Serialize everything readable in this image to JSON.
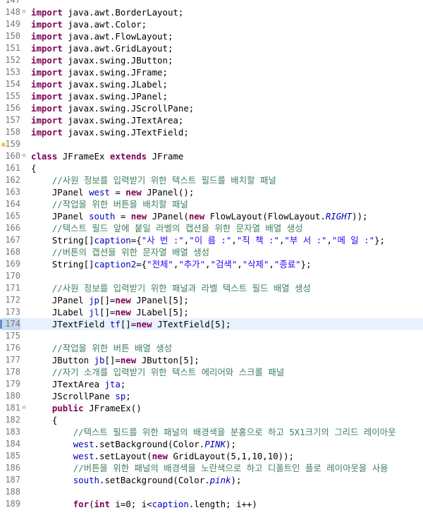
{
  "editor": {
    "lines": [
      {
        "num": "147",
        "tokens": []
      },
      {
        "num": "148",
        "fold": "⊖",
        "tokens": [
          {
            "t": "kw",
            "v": "import"
          },
          {
            "t": "tx",
            "v": " java.awt.BorderLayout;"
          }
        ]
      },
      {
        "num": "149",
        "tokens": [
          {
            "t": "kw",
            "v": "import"
          },
          {
            "t": "tx",
            "v": " java.awt.Color;"
          }
        ]
      },
      {
        "num": "150",
        "tokens": [
          {
            "t": "kw",
            "v": "import"
          },
          {
            "t": "tx",
            "v": " java.awt.FlowLayout;"
          }
        ]
      },
      {
        "num": "151",
        "tokens": [
          {
            "t": "kw",
            "v": "import"
          },
          {
            "t": "tx",
            "v": " java.awt.GridLayout;"
          }
        ]
      },
      {
        "num": "152",
        "tokens": [
          {
            "t": "kw",
            "v": "import"
          },
          {
            "t": "tx",
            "v": " javax.swing.JButton;"
          }
        ]
      },
      {
        "num": "153",
        "tokens": [
          {
            "t": "kw",
            "v": "import"
          },
          {
            "t": "tx",
            "v": " javax.swing.JFrame;"
          }
        ]
      },
      {
        "num": "154",
        "tokens": [
          {
            "t": "kw",
            "v": "import"
          },
          {
            "t": "tx",
            "v": " javax.swing.JLabel;"
          }
        ]
      },
      {
        "num": "155",
        "tokens": [
          {
            "t": "kw",
            "v": "import"
          },
          {
            "t": "tx",
            "v": " javax.swing.JPanel;"
          }
        ]
      },
      {
        "num": "156",
        "tokens": [
          {
            "t": "kw",
            "v": "import"
          },
          {
            "t": "tx",
            "v": " javax.swing.JScrollPane;"
          }
        ]
      },
      {
        "num": "157",
        "tokens": [
          {
            "t": "kw",
            "v": "import"
          },
          {
            "t": "tx",
            "v": " javax.swing.JTextArea;"
          }
        ]
      },
      {
        "num": "158",
        "tokens": [
          {
            "t": "kw",
            "v": "import"
          },
          {
            "t": "tx",
            "v": " javax.swing.JTextField;"
          }
        ]
      },
      {
        "num": "159",
        "warning": true,
        "tokens": []
      },
      {
        "num": "160",
        "fold": "⊖",
        "tokens": [
          {
            "t": "kw",
            "v": "class"
          },
          {
            "t": "tx",
            "v": " JFrameEx "
          },
          {
            "t": "kw",
            "v": "extends"
          },
          {
            "t": "tx",
            "v": " JFrame"
          }
        ]
      },
      {
        "num": "161",
        "tokens": [
          {
            "t": "tx",
            "v": "{"
          }
        ]
      },
      {
        "num": "162",
        "tokens": [
          {
            "t": "tx",
            "v": "    "
          },
          {
            "t": "cm",
            "v": "//사원 정보를 입력받기 위한 텍스트 필드를 배치할 패널"
          }
        ]
      },
      {
        "num": "163",
        "tokens": [
          {
            "t": "tx",
            "v": "    JPanel "
          },
          {
            "t": "fd",
            "v": "west"
          },
          {
            "t": "tx",
            "v": " = "
          },
          {
            "t": "kw",
            "v": "new"
          },
          {
            "t": "tx",
            "v": " JPanel();"
          }
        ]
      },
      {
        "num": "164",
        "tokens": [
          {
            "t": "tx",
            "v": "    "
          },
          {
            "t": "cm",
            "v": "//작업을 위한 버튼을 배치할 패널"
          }
        ]
      },
      {
        "num": "165",
        "tokens": [
          {
            "t": "tx",
            "v": "    JPanel "
          },
          {
            "t": "fd",
            "v": "south"
          },
          {
            "t": "tx",
            "v": " = "
          },
          {
            "t": "kw",
            "v": "new"
          },
          {
            "t": "tx",
            "v": " JPanel("
          },
          {
            "t": "kw",
            "v": "new"
          },
          {
            "t": "tx",
            "v": " FlowLayout(FlowLayout."
          },
          {
            "t": "it",
            "v": "RIGHT"
          },
          {
            "t": "tx",
            "v": "));"
          }
        ]
      },
      {
        "num": "166",
        "tokens": [
          {
            "t": "tx",
            "v": "    "
          },
          {
            "t": "cm",
            "v": "//텍스트 필드 앞에 붙일 라벨의 캡션을 위한 문자열 배열 생성"
          }
        ]
      },
      {
        "num": "167",
        "tokens": [
          {
            "t": "tx",
            "v": "    String[]"
          },
          {
            "t": "fd",
            "v": "caption"
          },
          {
            "t": "tx",
            "v": "={"
          },
          {
            "t": "st",
            "v": "\"사 번 :\""
          },
          {
            "t": "tx",
            "v": ","
          },
          {
            "t": "st",
            "v": "\"이 름 :\""
          },
          {
            "t": "tx",
            "v": ","
          },
          {
            "t": "st",
            "v": "\"직 책 :\""
          },
          {
            "t": "tx",
            "v": ","
          },
          {
            "t": "st",
            "v": "\"부 서 :\""
          },
          {
            "t": "tx",
            "v": ","
          },
          {
            "t": "st",
            "v": "\"메 일 :\""
          },
          {
            "t": "tx",
            "v": "};"
          }
        ]
      },
      {
        "num": "168",
        "tokens": [
          {
            "t": "tx",
            "v": "    "
          },
          {
            "t": "cm",
            "v": "//버튼의 캡션을 위한 문자열 배열 생성"
          }
        ]
      },
      {
        "num": "169",
        "tokens": [
          {
            "t": "tx",
            "v": "    String[]"
          },
          {
            "t": "fd",
            "v": "caption2"
          },
          {
            "t": "tx",
            "v": "={"
          },
          {
            "t": "st",
            "v": "\"전체\""
          },
          {
            "t": "tx",
            "v": ","
          },
          {
            "t": "st",
            "v": "\"추가\""
          },
          {
            "t": "tx",
            "v": ","
          },
          {
            "t": "st",
            "v": "\"검색\""
          },
          {
            "t": "tx",
            "v": ","
          },
          {
            "t": "st",
            "v": "\"삭제\""
          },
          {
            "t": "tx",
            "v": ","
          },
          {
            "t": "st",
            "v": "\"종료\""
          },
          {
            "t": "tx",
            "v": "};"
          }
        ]
      },
      {
        "num": "170",
        "tokens": []
      },
      {
        "num": "171",
        "tokens": [
          {
            "t": "tx",
            "v": "    "
          },
          {
            "t": "cm",
            "v": "//사원 정보를 입력받기 위한 패널과 라벨 텍스트 필드 배열 생성"
          }
        ]
      },
      {
        "num": "172",
        "tokens": [
          {
            "t": "tx",
            "v": "    JPanel "
          },
          {
            "t": "fd",
            "v": "jp"
          },
          {
            "t": "tx",
            "v": "[]="
          },
          {
            "t": "kw",
            "v": "new"
          },
          {
            "t": "tx",
            "v": " JPanel[5];"
          }
        ]
      },
      {
        "num": "173",
        "tokens": [
          {
            "t": "tx",
            "v": "    JLabel "
          },
          {
            "t": "fd",
            "v": "jl"
          },
          {
            "t": "tx",
            "v": "[]="
          },
          {
            "t": "kw",
            "v": "new"
          },
          {
            "t": "tx",
            "v": " JLabel[5];"
          }
        ]
      },
      {
        "num": "174",
        "current": true,
        "tokens": [
          {
            "t": "tx",
            "v": "    JTextField "
          },
          {
            "t": "fd",
            "v": "tf"
          },
          {
            "t": "tx",
            "v": "[]="
          },
          {
            "t": "kw",
            "v": "new"
          },
          {
            "t": "tx",
            "v": " JTextField[5];"
          }
        ]
      },
      {
        "num": "175",
        "tokens": []
      },
      {
        "num": "176",
        "tokens": [
          {
            "t": "tx",
            "v": "    "
          },
          {
            "t": "cm",
            "v": "//작업을 위한 버튼 배열 생성"
          }
        ]
      },
      {
        "num": "177",
        "tokens": [
          {
            "t": "tx",
            "v": "    JButton "
          },
          {
            "t": "fd",
            "v": "jb"
          },
          {
            "t": "tx",
            "v": "[]="
          },
          {
            "t": "kw",
            "v": "new"
          },
          {
            "t": "tx",
            "v": " JButton[5];"
          }
        ]
      },
      {
        "num": "178",
        "tokens": [
          {
            "t": "tx",
            "v": "    "
          },
          {
            "t": "cm",
            "v": "//자기 소개를 입력받기 위한 텍스트 에리어와 스크롤 패널"
          }
        ]
      },
      {
        "num": "179",
        "tokens": [
          {
            "t": "tx",
            "v": "    JTextArea "
          },
          {
            "t": "fd",
            "v": "jta"
          },
          {
            "t": "tx",
            "v": ";"
          }
        ]
      },
      {
        "num": "180",
        "tokens": [
          {
            "t": "tx",
            "v": "    JScrollPane "
          },
          {
            "t": "fd",
            "v": "sp"
          },
          {
            "t": "tx",
            "v": ";"
          }
        ]
      },
      {
        "num": "181",
        "fold": "⊖",
        "tokens": [
          {
            "t": "tx",
            "v": "    "
          },
          {
            "t": "kw",
            "v": "public"
          },
          {
            "t": "tx",
            "v": " JFrameEx()"
          }
        ]
      },
      {
        "num": "182",
        "tokens": [
          {
            "t": "tx",
            "v": "    {"
          }
        ]
      },
      {
        "num": "183",
        "tokens": [
          {
            "t": "tx",
            "v": "        "
          },
          {
            "t": "cm",
            "v": "//텍스트 필드를 위한 패널의 배경색을 분홍으로 하고 5X1크기의 그리드 레이아웃"
          }
        ]
      },
      {
        "num": "184",
        "tokens": [
          {
            "t": "tx",
            "v": "        "
          },
          {
            "t": "fd",
            "v": "west"
          },
          {
            "t": "tx",
            "v": ".setBackground(Color."
          },
          {
            "t": "it",
            "v": "PINK"
          },
          {
            "t": "tx",
            "v": ");"
          }
        ]
      },
      {
        "num": "185",
        "tokens": [
          {
            "t": "tx",
            "v": "        "
          },
          {
            "t": "fd",
            "v": "west"
          },
          {
            "t": "tx",
            "v": ".setLayout("
          },
          {
            "t": "kw",
            "v": "new"
          },
          {
            "t": "tx",
            "v": " GridLayout(5,1,10,10));"
          }
        ]
      },
      {
        "num": "186",
        "tokens": [
          {
            "t": "tx",
            "v": "        "
          },
          {
            "t": "cm",
            "v": "//버튼을 위한 패널의 배경색을 노란색으로 하고 디폴트인 플로 레이아웃을 사용"
          }
        ]
      },
      {
        "num": "187",
        "tokens": [
          {
            "t": "tx",
            "v": "        "
          },
          {
            "t": "fd",
            "v": "south"
          },
          {
            "t": "tx",
            "v": ".setBackground(Color."
          },
          {
            "t": "it",
            "v": "pink"
          },
          {
            "t": "tx",
            "v": ");"
          }
        ]
      },
      {
        "num": "188",
        "tokens": []
      },
      {
        "num": "189",
        "tokens": [
          {
            "t": "tx",
            "v": "        "
          },
          {
            "t": "kw",
            "v": "for"
          },
          {
            "t": "tx",
            "v": "("
          },
          {
            "t": "kw",
            "v": "int"
          },
          {
            "t": "tx",
            "v": " i=0; i<"
          },
          {
            "t": "fd",
            "v": "caption"
          },
          {
            "t": "tx",
            "v": ".length; i++)"
          }
        ]
      }
    ]
  },
  "colors": {
    "keyword": "#7f0055",
    "field": "#0000c0",
    "string": "#2a00ff",
    "comment": "#3f7f5f",
    "line_number": "#787878",
    "current_line": "#e8f2fe"
  },
  "icons": {
    "fold": "collapse-fold-icon",
    "warning": "warning-marker-icon",
    "current_line_marker": "current-line-marker"
  }
}
